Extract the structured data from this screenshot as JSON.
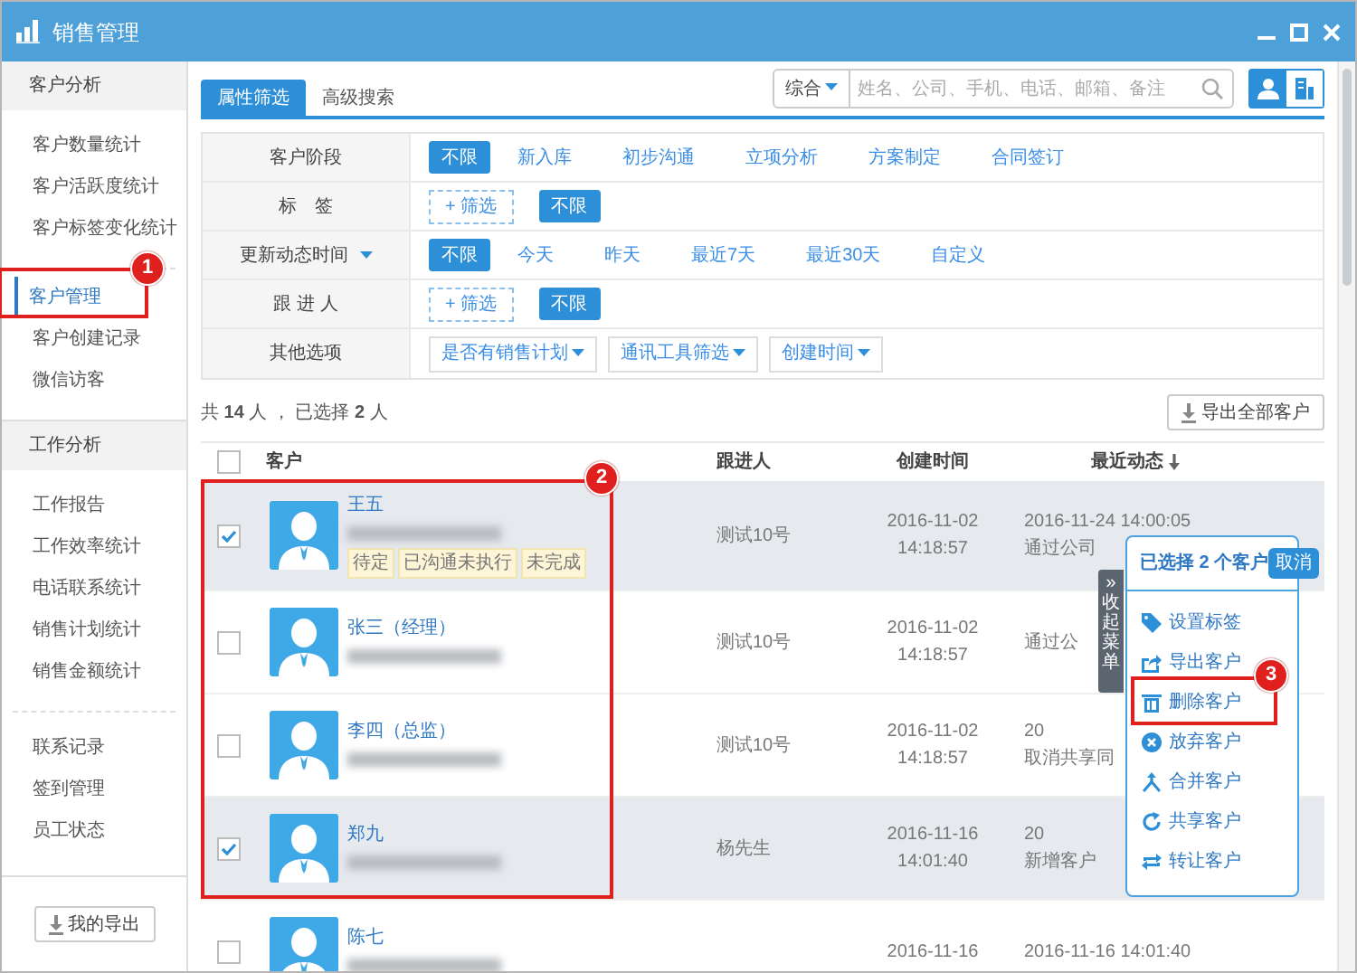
{
  "window": {
    "title": "销售管理"
  },
  "sidebar": {
    "sections": [
      {
        "heading": "客户分析",
        "items": [
          {
            "label": "客户数量统计",
            "selected": false
          },
          {
            "label": "客户活跃度统计",
            "selected": false
          },
          {
            "label": "客户标签变化统计",
            "selected": false
          }
        ]
      },
      {
        "items": [
          {
            "label": "客户管理",
            "selected": true,
            "callout": "1"
          },
          {
            "label": "客户创建记录",
            "selected": false
          },
          {
            "label": "微信访客",
            "selected": false
          }
        ]
      },
      {
        "heading": "工作分析",
        "items": [
          {
            "label": "工作报告",
            "selected": false
          },
          {
            "label": "工作效率统计",
            "selected": false
          },
          {
            "label": "电话联系统计",
            "selected": false
          },
          {
            "label": "销售计划统计",
            "selected": false
          },
          {
            "label": "销售金额统计",
            "selected": false
          }
        ]
      },
      {
        "items": [
          {
            "label": "联系记录",
            "selected": false
          },
          {
            "label": "签到管理",
            "selected": false
          },
          {
            "label": "员工状态",
            "selected": false
          }
        ]
      }
    ],
    "export_button": "我的导出"
  },
  "tabs": [
    {
      "label": "属性筛选",
      "selected": true
    },
    {
      "label": "高级搜索",
      "selected": false
    }
  ],
  "search": {
    "scope": "综合",
    "placeholder": "姓名、公司、手机、电话、邮箱、备注"
  },
  "view_toggle": [
    {
      "kind": "person",
      "selected": true
    },
    {
      "kind": "company",
      "selected": false
    }
  ],
  "filters": [
    {
      "label": "客户阶段",
      "kind": "options",
      "options": [
        {
          "label": "不限",
          "selected": true
        },
        {
          "label": "新入库",
          "selected": false
        },
        {
          "label": "初步沟通",
          "selected": false
        },
        {
          "label": "立项分析",
          "selected": false
        },
        {
          "label": "方案制定",
          "selected": false
        },
        {
          "label": "合同签订",
          "selected": false
        }
      ]
    },
    {
      "label": "标　签",
      "kind": "tags",
      "add": "+ 筛选",
      "options": [
        {
          "label": "不限",
          "selected": true
        }
      ]
    },
    {
      "label": "更新动态时间",
      "kind": "options",
      "dropdown": true,
      "options": [
        {
          "label": "不限",
          "selected": true
        },
        {
          "label": "今天",
          "selected": false
        },
        {
          "label": "昨天",
          "selected": false
        },
        {
          "label": "最近7天",
          "selected": false
        },
        {
          "label": "最近30天",
          "selected": false
        },
        {
          "label": "自定义",
          "selected": false
        }
      ]
    },
    {
      "label": "跟 进 人",
      "kind": "tags",
      "add": "+ 筛选",
      "options": [
        {
          "label": "不限",
          "selected": true
        }
      ]
    },
    {
      "label": "其他选项",
      "kind": "dropdowns",
      "options": [
        {
          "label": "是否有销售计划"
        },
        {
          "label": "通讯工具筛选"
        },
        {
          "label": "创建时间"
        }
      ]
    }
  ],
  "summary": "共 **14** 人 ， 已选择 **2** 人",
  "export_all_button": "导出全部客户",
  "table": {
    "columns": [
      "客户",
      "跟进人",
      "创建时间",
      "最近动态"
    ],
    "all_selected": false,
    "callout": "2",
    "rows": [
      {
        "selected": true,
        "name": "王五",
        "tags": [
          "待定",
          "已沟通未执行",
          "未完成"
        ],
        "owner": "测试10号",
        "created": [
          "2016-11-02",
          "14:18:57"
        ],
        "activity": [
          "2016-11-24 14:00:05",
          "通过公司"
        ]
      },
      {
        "selected": false,
        "name": "张三（经理）",
        "owner": "测试10号",
        "created": [
          "2016-11-02",
          "14:18:57"
        ],
        "activity": [
          "通过公"
        ]
      },
      {
        "selected": false,
        "name": "李四（总监）",
        "owner": "测试10号",
        "created": [
          "2016-11-02",
          "14:18:57"
        ],
        "activity": [
          "20",
          "取消共享同"
        ]
      },
      {
        "selected": true,
        "name": "郑九",
        "owner": "杨先生",
        "created": [
          "2016-11-16",
          "14:01:40"
        ],
        "activity": [
          "20",
          "新增客户"
        ]
      },
      {
        "selected": false,
        "name": "陈七",
        "created": [
          "2016-11-16"
        ],
        "activity": [
          "2016-11-16 14:01:40"
        ]
      }
    ]
  },
  "selection_panel": {
    "title": "已选择 **2** 个客户",
    "cancel": "取消",
    "collapse_glyph": "»",
    "collapse_label": "收起菜单",
    "actions": [
      {
        "kind": "tag",
        "label": "设置标签"
      },
      {
        "kind": "export",
        "label": "导出客户"
      },
      {
        "kind": "delete",
        "label": "删除客户",
        "callout": "3"
      },
      {
        "kind": "abandon",
        "label": "放弃客户"
      },
      {
        "kind": "merge",
        "label": "合并客户"
      },
      {
        "kind": "share",
        "label": "共享客户"
      },
      {
        "kind": "transfer",
        "label": "转让客户"
      }
    ]
  }
}
